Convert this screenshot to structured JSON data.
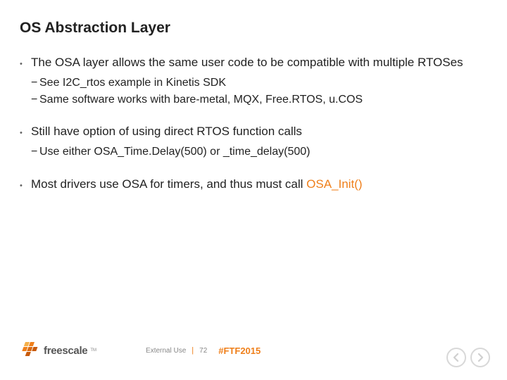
{
  "title": "OS Abstraction Layer",
  "bullets": [
    {
      "text": "The OSA layer allows the same user code to be compatible with multiple RTOSes",
      "subs": [
        "See I2C_rtos example in Kinetis SDK",
        "Same software works with bare-metal, MQX, Free.RTOS, u.COS"
      ]
    },
    {
      "text": "Still have option of using direct RTOS function calls",
      "subs": [
        "Use either OSA_Time.Delay(500) or _time_delay(500)"
      ]
    },
    {
      "text_pre": "Most drivers use OSA for timers, and thus must call ",
      "text_accent": "OSA_Init()",
      "subs": []
    }
  ],
  "footer": {
    "brand": "freescale",
    "usage": "External Use",
    "page": "72",
    "hashtag": "#FTF2015"
  },
  "icons": {
    "prev": "chevron-left",
    "next": "chevron-right"
  },
  "colors": {
    "accent": "#ef7f1a"
  }
}
